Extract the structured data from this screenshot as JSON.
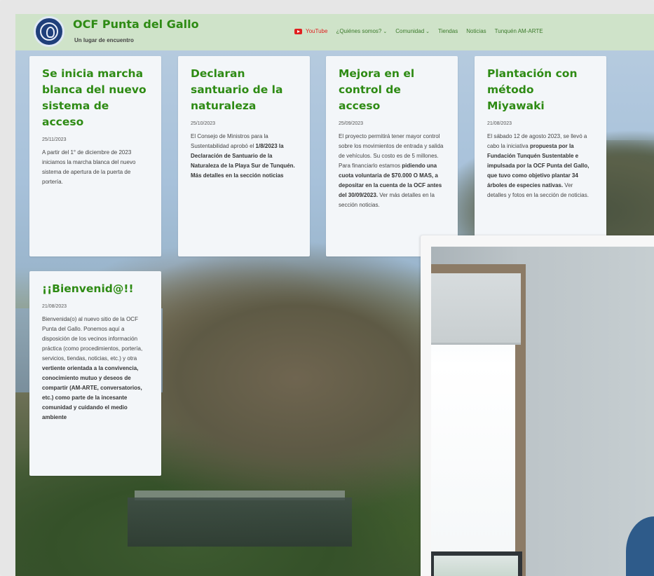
{
  "header": {
    "site_title": "OCF Punta del Gallo",
    "tagline": "Un lugar de encuentro",
    "nav": [
      {
        "label": "YouTube",
        "icon": "youtube-icon",
        "dropdown": false
      },
      {
        "label": "¿Quiénes somos?",
        "dropdown": true
      },
      {
        "label": "Comunidad",
        "dropdown": true
      },
      {
        "label": "Tiendas",
        "dropdown": false
      },
      {
        "label": "Noticias",
        "dropdown": false
      },
      {
        "label": "Tunquén AM-ARTE",
        "dropdown": false
      }
    ]
  },
  "cards": [
    {
      "title": "Se inicia marcha blanca del nuevo sistema de acceso",
      "date": "25/11/2023",
      "body": "A partir del 1° de diciembre de 2023 iniciamos la marcha blanca del nuevo sistema de apertura de la puerta de portería."
    },
    {
      "title": "Declaran santuario de la naturaleza",
      "date": "25/10/2023",
      "body_plain": "El Consejo de Ministros para la Sustentabilidad aprobó el",
      "body_bold": "1/8/2023 la Declaración de Santuario de la Naturaleza de la Playa Sur de Tunquén. Más detalles en la sección noticias"
    },
    {
      "title": "Mejora en el control de acceso",
      "date": "25/09/2023",
      "body_plain": "El proyecto permitirá tener mayor control sobre los movimientos de entrada y salida de vehículos. Su costo es de 5 millones. Para financiarlo estamos",
      "body_bold": "pidiendo una cuota voluntaria de $70.000 O MAS, a depositar en la cuenta de la OCF antes del 30/09/2023.",
      "body_tail": "Ver más detalles en la sección noticias."
    },
    {
      "title": "Plantación con método Miyawaki",
      "date": "21/08/2023",
      "body_plain": "El sábado 12 de agosto 2023, se llevó a cabo la iniciativa",
      "body_bold": "propuesta por la Fundación Tunquén Sustentable e impulsada por la OCF Punta del Gallo, que tuvo como objetivo plantar 34 árboles de especies nativas.",
      "body_tail": "Ver detalles y fotos en la sección de noticias."
    },
    {
      "title": "¡¡Bienvenid@!!",
      "date": "21/08/2023",
      "body_plain": "Bienvenida(o) al nuevo sitio de la OCF Punta del Gallo. Ponemos aquí a disposición de los vecinos información práctica (como procedimientos, portería, servicios, tiendas, noticias, etc.) y otra",
      "body_bold": "vertiente orientada a la convivencia, conocimiento mutuo y deseos de compartir (AM-ARTE, conversatorios, etc.) como parte de la incesante comunidad y cuidando el medio ambiente"
    }
  ],
  "colors": {
    "brand_green": "#2e8b14",
    "header_bg": "#cfe3c9",
    "card_bg": "#f3f6f9",
    "youtube_red": "#e02020"
  }
}
